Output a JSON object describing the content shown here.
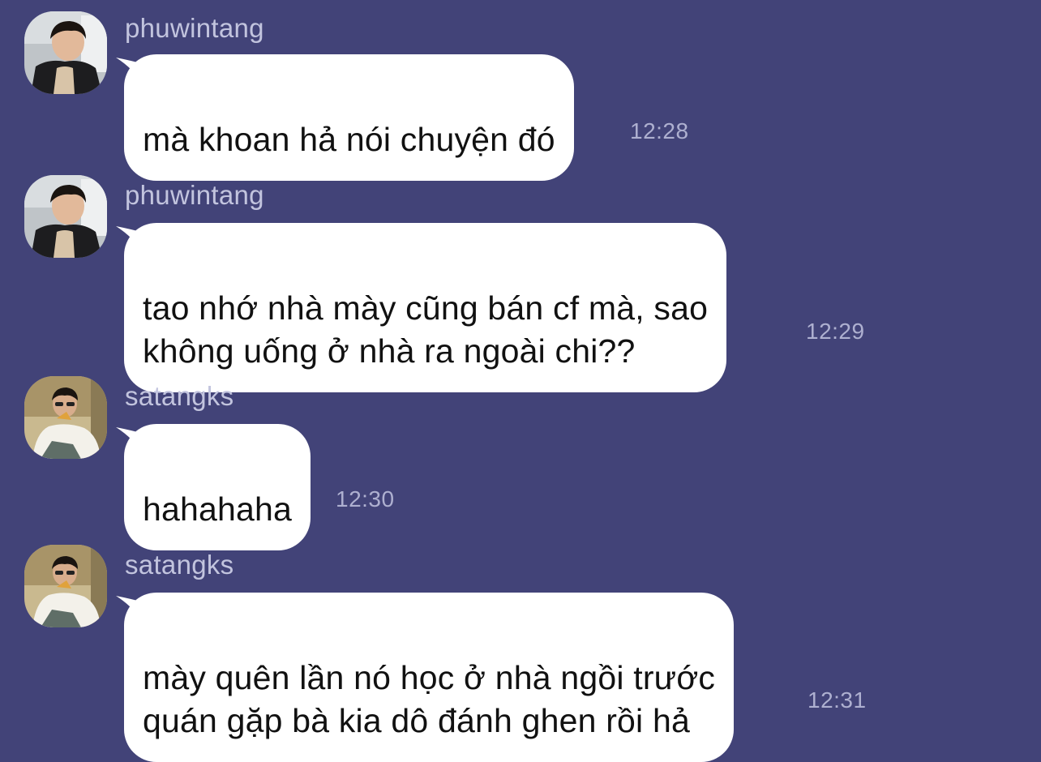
{
  "messages": [
    {
      "username": "phuwintang",
      "text": "mà khoan hả nói chuyện đó",
      "time": "12:28",
      "avatar": "avatar-phuwintang"
    },
    {
      "username": "phuwintang",
      "text": "tao nhớ nhà mày cũng bán cf mà, sao\nkhông uống ở nhà ra ngoài chi??",
      "time": "12:29",
      "avatar": "avatar-phuwintang"
    },
    {
      "username": "satangks",
      "text": "hahahaha",
      "time": "12:30",
      "avatar": "avatar-satangks"
    },
    {
      "username": "satangks",
      "text": "mày quên lần nó học ở nhà ngồi trước\nquán gặp bà kia dô đánh ghen rồi hả",
      "time": "12:31",
      "avatar": "avatar-satangks"
    }
  ],
  "colors": {
    "background": "#424378",
    "bubble": "#ffffff",
    "username": "#c2c4de",
    "timestamp": "#aeb0d0"
  }
}
